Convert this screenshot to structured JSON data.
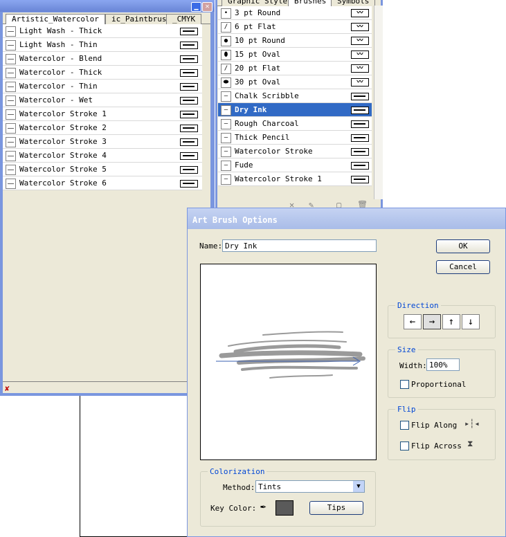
{
  "left_palette": {
    "tabs": [
      "Artistic_Watercolor",
      "ic_Paintbrush",
      "_CMYK"
    ],
    "brushes": [
      "Light Wash - Thick",
      "Light Wash - Thin",
      "Watercolor - Blend",
      "Watercolor - Thick",
      "Watercolor - Thin",
      "Watercolor - Wet",
      "Watercolor Stroke 1",
      "Watercolor Stroke 2",
      "Watercolor Stroke 3",
      "Watercolor Stroke 4",
      "Watercolor Stroke 5",
      "Watercolor Stroke 6"
    ],
    "minimize_glyph": "▁",
    "close_glyph": "✕"
  },
  "right_palette": {
    "tabs": [
      "Graphic Styles",
      "Brushes",
      "Symbols"
    ],
    "brushes": [
      "3 pt Round",
      "6 pt Flat",
      "10 pt Round",
      "15 pt Oval",
      "20 pt Flat",
      "30 pt Oval",
      "Chalk Scribble",
      "Dry Ink",
      "Rough Charcoal",
      "Thick Pencil",
      "Watercolor Stroke",
      "Fude",
      "Watercolor Stroke 1"
    ],
    "selected": "Dry Ink"
  },
  "dialog": {
    "title": "Art Brush Options",
    "name_label": "Name:",
    "name_value": "Dry Ink",
    "ok_label": "OK",
    "cancel_label": "Cancel",
    "direction_title": "Direction",
    "direction_buttons": [
      "←",
      "→",
      "↑",
      "↓"
    ],
    "size_title": "Size",
    "width_label": "Width:",
    "width_value": "100%",
    "proportional_label": "Proportional",
    "flip_title": "Flip",
    "flip_along_label": "Flip Along",
    "flip_across_label": "Flip Across",
    "colorization_title": "Colorization",
    "method_label": "Method:",
    "method_value": "Tints",
    "key_color_label": "Key Color:",
    "tips_label": "Tips",
    "key_color": "#5a5a5a"
  }
}
